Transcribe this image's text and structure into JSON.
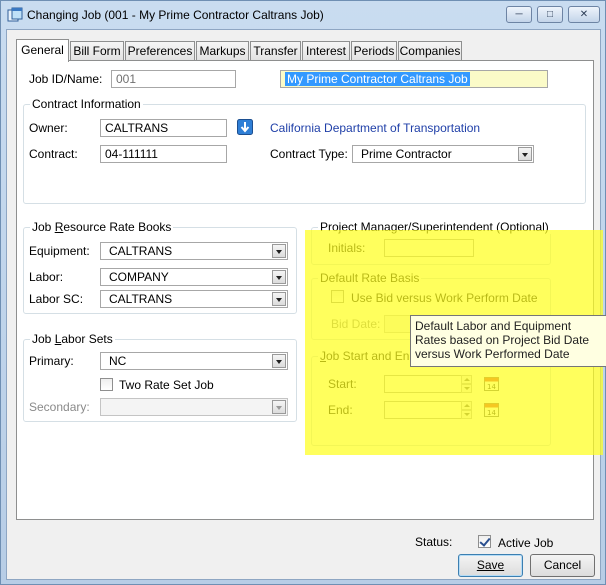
{
  "window": {
    "title": "Changing Job  (001 - My Prime Contractor Caltrans Job)",
    "controls": {
      "minimize": "─",
      "maximize": "□",
      "close": "✕"
    }
  },
  "tabs": [
    "General",
    "Bill Form",
    "Preferences",
    "Markups",
    "Transfer",
    "Interest",
    "Periods",
    "Companies"
  ],
  "general": {
    "job_id_label": "Job ID/Name:",
    "job_id": "001",
    "job_name": "My Prime Contractor Caltrans Job",
    "contract_info": {
      "title": "Contract Information",
      "owner_label": "Owner:",
      "owner": "CALTRANS",
      "owner_name": "California Department of Transportation",
      "contract_label": "Contract:",
      "contract": "04-111111",
      "contract_type_label": "Contract Type:",
      "contract_type": "Prime Contractor"
    },
    "rate_books": {
      "title": "Job Resource Rate Books",
      "equipment_label": "Equipment:",
      "equipment": "CALTRANS",
      "labor_label": "Labor:",
      "labor": "COMPANY",
      "labor_sc_label": "Labor SC:",
      "labor_sc": "CALTRANS"
    },
    "labor_sets": {
      "title": "Job Labor Sets",
      "primary_label": "Primary:",
      "primary": "NC",
      "two_rate_label": "Two Rate Set Job",
      "secondary_label": "Secondary:",
      "secondary": ""
    },
    "project_manager": {
      "title": "Project Manager/Superintendent (Optional)",
      "initials_label": "Initials:",
      "initials": ""
    },
    "default_rate_basis": {
      "title": "Default Rate Basis",
      "use_bid_label": "Use Bid versus Work Perform Date",
      "bid_date_label": "Bid Date:",
      "bid_date": ""
    },
    "job_dates": {
      "title": "Job Start and En",
      "start_label": "Start:",
      "start": "",
      "end_label": "End:",
      "end": ""
    },
    "tooltip": "Default Labor and Equipment Rates based on Project Bid Date versus Work Performed Date",
    "status_label": "Status:",
    "active_job_label": "Active Job"
  },
  "buttons": {
    "save": "Save",
    "cancel": "Cancel"
  },
  "colors": {
    "highlight": "#ffff1e",
    "tooltip_bg": "#ffffe1",
    "link": "#1f3fa8",
    "selection": "#3399ff"
  },
  "icons": [
    "app-window-icon",
    "arrow-down-icon",
    "calendar-icon",
    "checkbox-checked-icon"
  ]
}
